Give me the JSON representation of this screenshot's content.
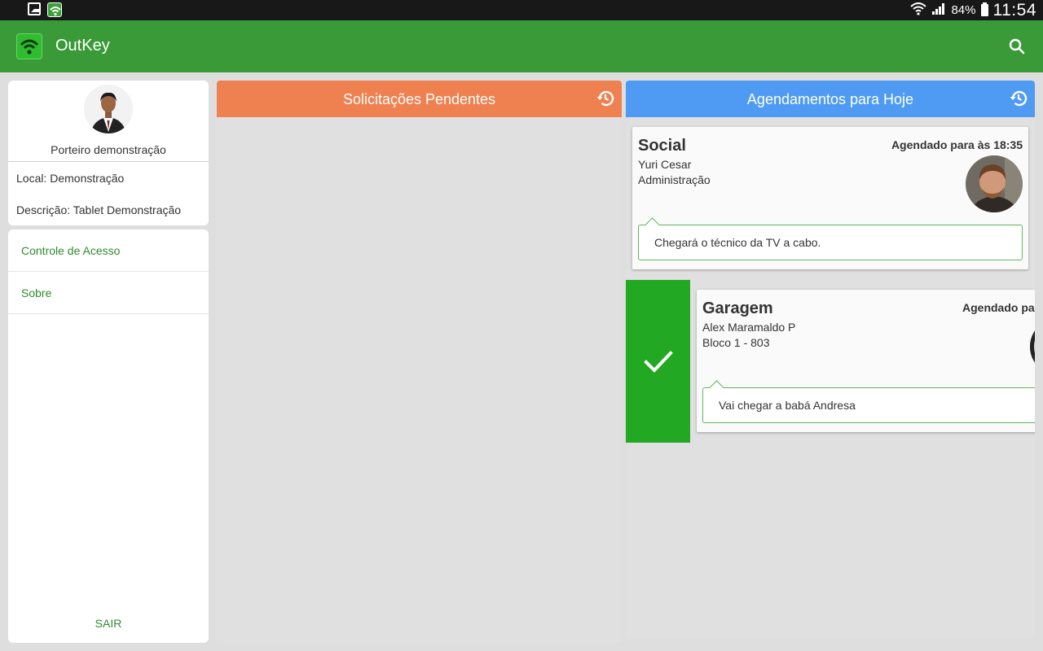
{
  "status_bar": {
    "battery": "84%",
    "time": "11:54",
    "icons": [
      "gallery-notification-icon",
      "outkey-notification-icon",
      "wifi-icon",
      "signal-icon",
      "battery-icon"
    ]
  },
  "app_bar": {
    "title": "OutKey",
    "icons": [
      "outkey-logo-icon",
      "search-icon"
    ],
    "color": "#3a9a38"
  },
  "profile": {
    "name": "Porteiro demonstração",
    "local": "Local: Demonstração",
    "description": "Descrição: Tablet Demonstração"
  },
  "menu": {
    "items": [
      {
        "label": "Controle de Acesso"
      },
      {
        "label": "Sobre"
      }
    ],
    "logout_label": "SAIR",
    "link_color": "#2e8b2e"
  },
  "pending": {
    "title": "Solicitações Pendentes",
    "icon": "history-icon",
    "color": "#ef8050"
  },
  "today": {
    "title": "Agendamentos para Hoje",
    "icon": "history-icon",
    "color": "#4f9bf3",
    "cards": [
      {
        "type": "Social",
        "when": "Agendado para às 18:35",
        "person": "Yuri Cesar",
        "unit": "Administração",
        "note": "Chegará o técnico da TV a cabo."
      },
      {
        "type": "Garagem",
        "when": "Agendado para às",
        "person": "Alex Maramaldo P",
        "unit": "Bloco 1 - 803",
        "note": "Vai chegar a babá Andresa",
        "swipe_action_icon": "checkmark-icon",
        "swipe_action_color": "#22a822"
      }
    ]
  }
}
